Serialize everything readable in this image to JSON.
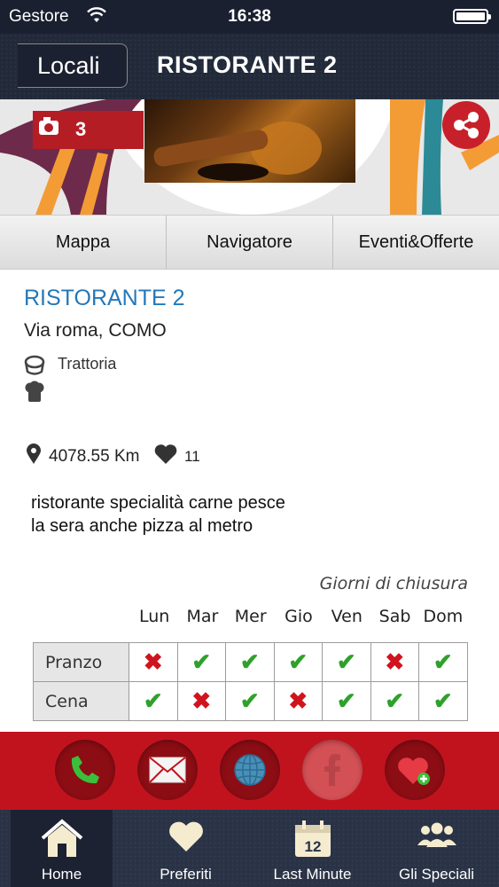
{
  "status_bar": {
    "carrier": "Gestore",
    "time": "16:38"
  },
  "nav": {
    "back_label": "Locali",
    "title": "RISTORANTE 2"
  },
  "hero": {
    "photo_count": "3"
  },
  "tabs": [
    {
      "label": "Mappa"
    },
    {
      "label": "Navigatore"
    },
    {
      "label": "Eventi&Offerte"
    }
  ],
  "restaurant": {
    "name": "RISTORANTE 2",
    "address": "Via roma, COMO",
    "category": "Trattoria",
    "distance": "4078.55 Km",
    "likes": "11",
    "description_line1": "ristorante specialità carne pesce",
    "description_line2": "la sera anche pizza al metro"
  },
  "closing": {
    "title": "Giorni di chiusura",
    "days": [
      "Lun",
      "Mar",
      "Mer",
      "Gio",
      "Ven",
      "Sab",
      "Dom"
    ],
    "rows": [
      {
        "label": "Pranzo",
        "open": [
          false,
          true,
          true,
          true,
          true,
          false,
          true
        ]
      },
      {
        "label": "Cena",
        "open": [
          true,
          false,
          true,
          false,
          true,
          true,
          true
        ]
      }
    ]
  },
  "actions": [
    {
      "icon": "phone-icon"
    },
    {
      "icon": "mail-icon"
    },
    {
      "icon": "globe-icon"
    },
    {
      "icon": "facebook-icon",
      "disabled": true
    },
    {
      "icon": "favorite-add-icon"
    }
  ],
  "tabbar": [
    {
      "label": "Home",
      "icon": "home-icon",
      "active": true
    },
    {
      "label": "Preferiti",
      "icon": "heart-icon"
    },
    {
      "label": "Last Minute",
      "icon": "calendar-icon",
      "badge": "12"
    },
    {
      "label": "Gli Speciali",
      "icon": "group-icon"
    }
  ],
  "colors": {
    "accent_red": "#c1131e",
    "link_blue": "#2478b8",
    "nav_dark": "#222a3a"
  }
}
